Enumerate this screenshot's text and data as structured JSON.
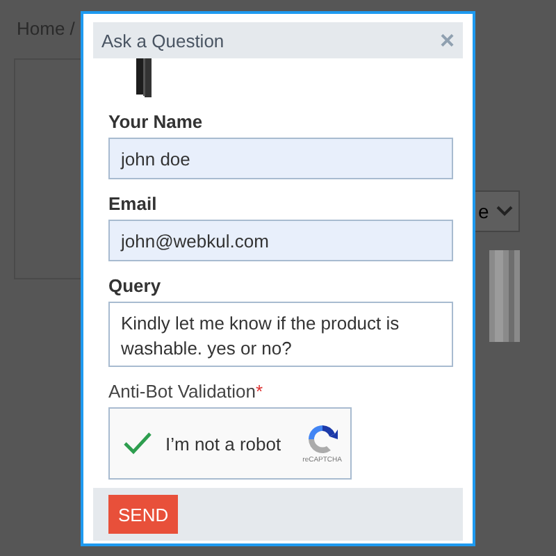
{
  "page": {
    "breadcrumb": "Home /",
    "sort_select": "e"
  },
  "dialog": {
    "title": "Ask a Question",
    "close": "×",
    "fields": [
      {
        "label": "Your Name",
        "value": "john doe",
        "kind": "input",
        "filled": true
      },
      {
        "label": "Email",
        "value": "john@webkul.com",
        "kind": "input",
        "filled": true
      },
      {
        "label": "Query",
        "value": "Kindly let me know if the product is washable. yes or no?",
        "kind": "textarea",
        "filled": false
      }
    ],
    "captcha": {
      "label": "Anti-Bot Validation",
      "required": "*",
      "text": "I’m not a robot",
      "checked": true,
      "brand": "reCAPTCHA"
    },
    "send": "SEND"
  }
}
